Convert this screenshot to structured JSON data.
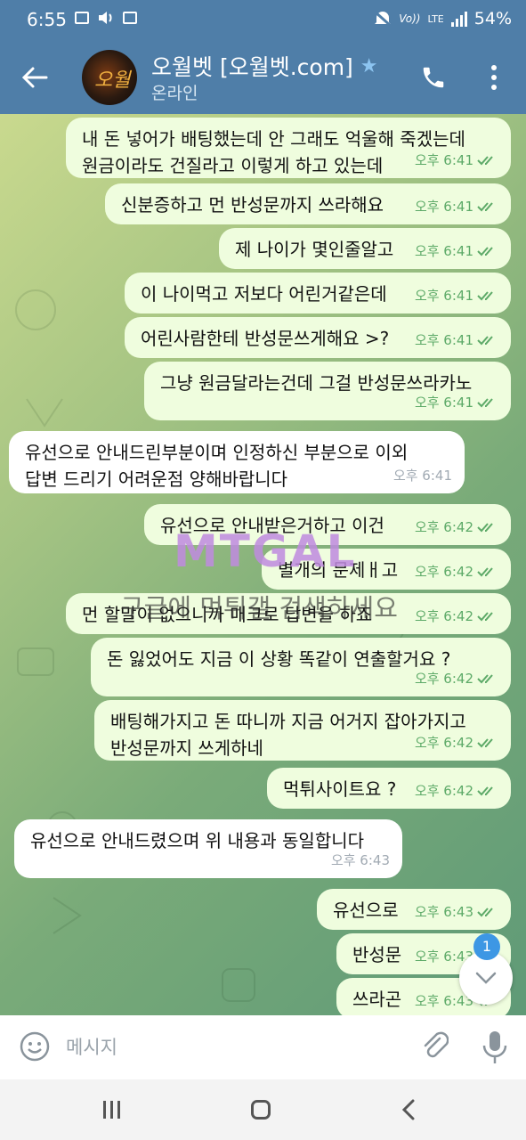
{
  "status_bar": {
    "time": "6:55",
    "network": "LTE",
    "battery": "54%"
  },
  "header": {
    "title": "오월벳 [오월벳.com]",
    "subtitle": "온라인",
    "verified_icon": "star-icon"
  },
  "colors": {
    "header_bg": "#4f7ea8",
    "outgoing_bubble": "#effdde",
    "incoming_bubble": "#ffffff",
    "read_check": "#5daa68",
    "badge": "#3d97e4"
  },
  "messages": [
    {
      "dir": "out",
      "lines": [
        "내 돈 넣어가 배팅했는데 안 그래도 억울해 죽겠는데",
        "원금이라도 건질라고 이렇게 하고 있는데"
      ],
      "time": "오후 6:41"
    },
    {
      "dir": "out",
      "lines": [
        "신분증하고 먼 반성문까지 쓰라해요"
      ],
      "time": "오후 6:41"
    },
    {
      "dir": "out",
      "lines": [
        "제 나이가 몇인줄알고"
      ],
      "time": "오후 6:41"
    },
    {
      "dir": "out",
      "lines": [
        "이 나이먹고 저보다 어린거같은데"
      ],
      "time": "오후 6:41"
    },
    {
      "dir": "out",
      "lines": [
        "어린사람한테 반성문쓰게해요 >?"
      ],
      "time": "오후 6:41"
    },
    {
      "dir": "out",
      "lines": [
        "그냥 원금달라는건데 그걸 반성문쓰라카노"
      ],
      "time": "오후 6:41"
    },
    {
      "dir": "in",
      "lines": [
        "유선으로 안내드린부분이며 인정하신 부분으로 이외",
        "답변 드리기 어려운점 양해바랍니다"
      ],
      "time": "오후 6:41"
    },
    {
      "dir": "out",
      "lines": [
        "유선으로 안내받은거하고 이건"
      ],
      "time": "오후 6:42"
    },
    {
      "dir": "out",
      "lines": [
        "별개의 문제ㅐ고"
      ],
      "time": "오후 6:42"
    },
    {
      "dir": "out",
      "lines": [
        "먼 할말이 없으니까 매크로 답변을 하죠"
      ],
      "time": "오후 6:42"
    },
    {
      "dir": "out",
      "lines": [
        "돈 잃었어도 지금 이 상황 똑같이 연출할거요 ?"
      ],
      "time": "오후 6:42"
    },
    {
      "dir": "out",
      "lines": [
        "배팅해가지고 돈 따니까 지금 어거지 잡아가지고",
        "반성문까지 쓰게하네"
      ],
      "time": "오후 6:42"
    },
    {
      "dir": "out",
      "lines": [
        "먹튀사이트요 ?"
      ],
      "time": "오후 6:42"
    },
    {
      "dir": "in",
      "lines": [
        "유선으로 안내드렸으며 위 내용과 동일합니다"
      ],
      "time": "오후 6:43"
    },
    {
      "dir": "out",
      "lines": [
        "유선으로"
      ],
      "time": "오후 6:43"
    },
    {
      "dir": "out",
      "lines": [
        "반성문"
      ],
      "time": "오후 6:43"
    },
    {
      "dir": "out",
      "lines": [
        "쓰라곤"
      ],
      "time": "오후 6:43"
    }
  ],
  "watermark": {
    "logo": "MTGAL",
    "text": "구글에 먹튀갤 검색하세요"
  },
  "scroll_badge": "1",
  "input": {
    "placeholder": "메시지"
  }
}
